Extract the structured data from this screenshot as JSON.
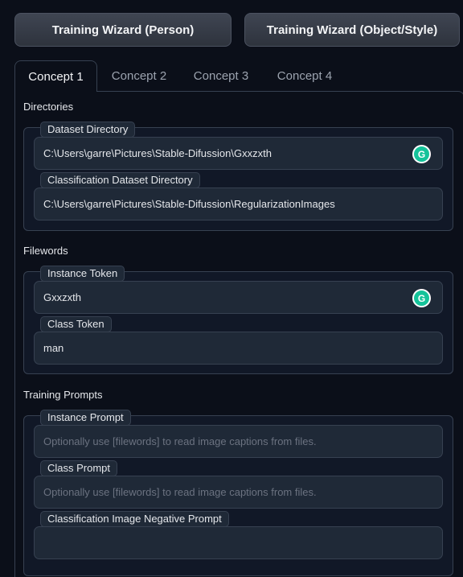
{
  "wizard": {
    "person_label": "Training Wizard (Person)",
    "object_label": "Training Wizard (Object/Style)"
  },
  "tabs": [
    {
      "label": "Concept 1",
      "active": true
    },
    {
      "label": "Concept 2",
      "active": false
    },
    {
      "label": "Concept 3",
      "active": false
    },
    {
      "label": "Concept 4",
      "active": false
    }
  ],
  "directories": {
    "title": "Directories",
    "dataset_label": "Dataset Directory",
    "dataset_value": "C:\\Users\\garre\\Pictures\\Stable-Difussion\\Gxxzxth",
    "classification_label": "Classification Dataset Directory",
    "classification_value": "C:\\Users\\garre\\Pictures\\Stable-Difussion\\RegularizationImages"
  },
  "filewords": {
    "title": "Filewords",
    "instance_token_label": "Instance Token",
    "instance_token_value": "Gxxzxth",
    "class_token_label": "Class Token",
    "class_token_value": "man"
  },
  "prompts": {
    "title": "Training Prompts",
    "instance_prompt_label": "Instance Prompt",
    "instance_prompt_placeholder": "Optionally use [filewords] to read image captions from files.",
    "class_prompt_label": "Class Prompt",
    "class_prompt_placeholder": "Optionally use [filewords] to read image captions from files.",
    "negative_prompt_label": "Classification Image Negative Prompt",
    "negative_prompt_value": ""
  },
  "icons": {
    "grammarly": "grammarly-icon",
    "grammarly_color": "#15c39a"
  }
}
